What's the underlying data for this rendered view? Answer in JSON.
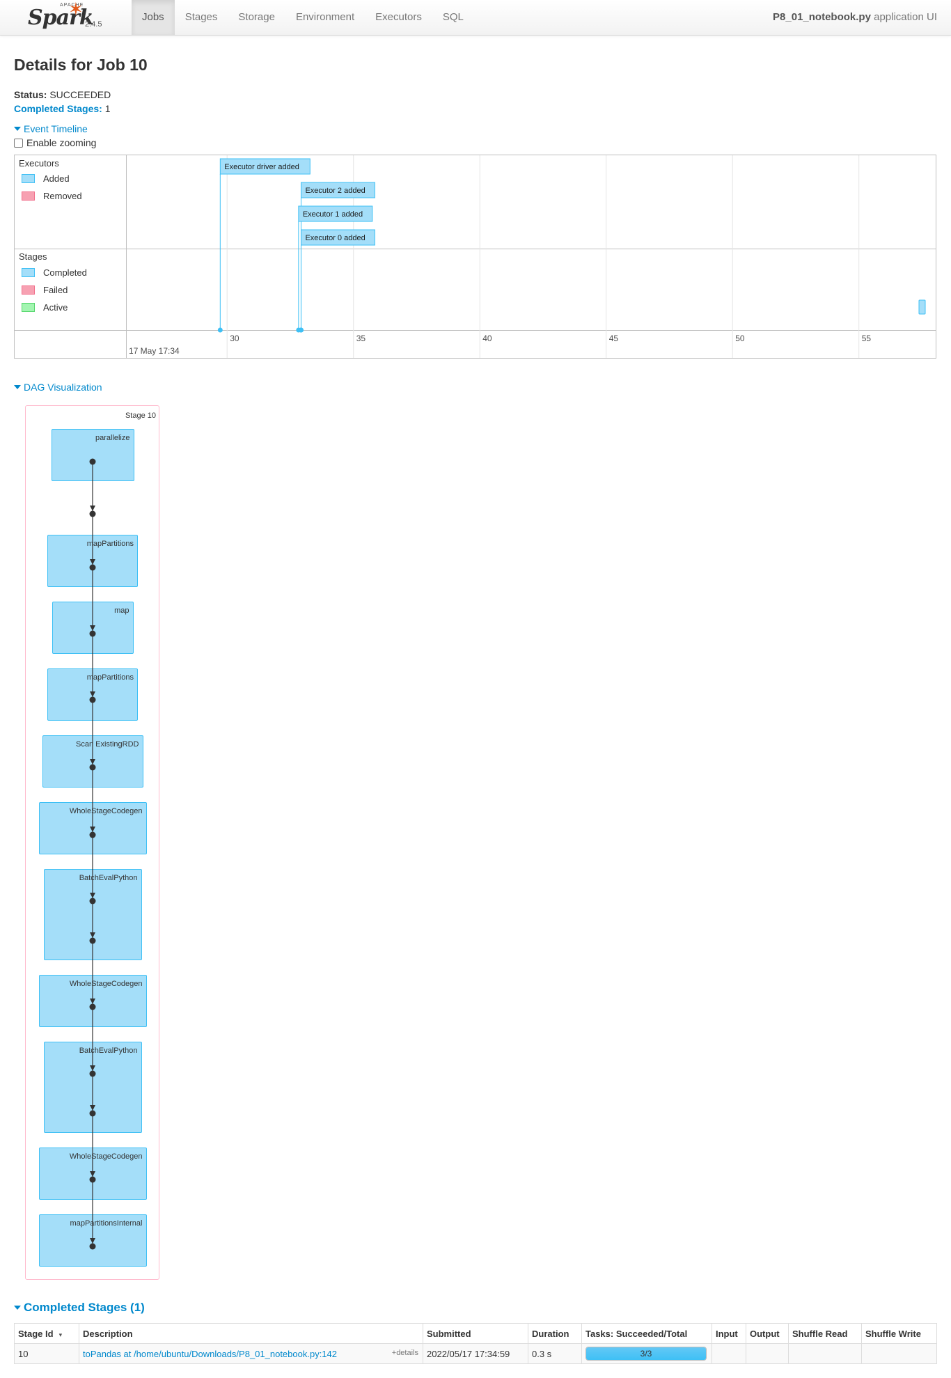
{
  "navbar": {
    "logo": {
      "apache": "APACHE",
      "name": "Spark",
      "version": "2.4.5"
    },
    "tabs": [
      {
        "label": "Jobs",
        "active": true
      },
      {
        "label": "Stages",
        "active": false
      },
      {
        "label": "Storage",
        "active": false
      },
      {
        "label": "Environment",
        "active": false
      },
      {
        "label": "Executors",
        "active": false
      },
      {
        "label": "SQL",
        "active": false
      }
    ],
    "app_name": "P8_01_notebook.py",
    "app_suffix": "application UI"
  },
  "page": {
    "title": "Details for Job 10",
    "status_label": "Status:",
    "status_value": "SUCCEEDED",
    "completed_stages_label": "Completed Stages:",
    "completed_stages_value": "1"
  },
  "event_timeline": {
    "toggle_label": "Event Timeline",
    "zoom_label": "Enable zooming",
    "zoom_enabled": false,
    "executors_group": {
      "title": "Executors",
      "legend": [
        {
          "label": "Added",
          "color": "#a4def9",
          "border": "#3ec0f5"
        },
        {
          "label": "Removed",
          "color": "#f7a1b2",
          "border": "#f16d8a"
        }
      ],
      "events": [
        {
          "label": "Executor driver added",
          "time_s": 29.7
        },
        {
          "label": "Executor 2 added",
          "time_s": 32.9
        },
        {
          "label": "Executor 1 added",
          "time_s": 32.8
        },
        {
          "label": "Executor 0 added",
          "time_s": 32.9
        }
      ]
    },
    "stages_group": {
      "title": "Stages",
      "legend": [
        {
          "label": "Completed",
          "color": "#a4def9",
          "border": "#3ec0f5"
        },
        {
          "label": "Failed",
          "color": "#f7a1b2",
          "border": "#f16d8a"
        },
        {
          "label": "Active",
          "color": "#a3f5b1",
          "border": "#54d56b"
        }
      ]
    },
    "axis": {
      "ticks": [
        "30",
        "35",
        "40",
        "45",
        "50",
        "55"
      ],
      "start_label": "17 May 17:34"
    }
  },
  "dag": {
    "toggle_label": "DAG Visualization",
    "stage_label": "Stage 10",
    "nodes": [
      {
        "label": "parallelize"
      },
      {
        "label": "mapPartitions"
      },
      {
        "label": "map"
      },
      {
        "label": "mapPartitions"
      },
      {
        "label": "Scan ExistingRDD"
      },
      {
        "label": "WholeStageCodegen"
      },
      {
        "label": "BatchEvalPython"
      },
      {
        "label": "WholeStageCodegen"
      },
      {
        "label": "BatchEvalPython"
      },
      {
        "label": "WholeStageCodegen"
      },
      {
        "label": "mapPartitionsInternal"
      }
    ]
  },
  "completed_stages": {
    "title": "Completed Stages (1)",
    "columns": [
      "Stage Id",
      "Description",
      "Submitted",
      "Duration",
      "Tasks: Succeeded/Total",
      "Input",
      "Output",
      "Shuffle Read",
      "Shuffle Write"
    ],
    "rows": [
      {
        "stage_id": "10",
        "description": "toPandas at /home/ubuntu/Downloads/P8_01_notebook.py:142",
        "details": "+details",
        "submitted": "2022/05/17 17:34:59",
        "duration": "0.3 s",
        "tasks_text": "3/3",
        "tasks_fraction": 1.0,
        "input": "",
        "output": "",
        "shuffle_read": "",
        "shuffle_write": ""
      }
    ]
  }
}
